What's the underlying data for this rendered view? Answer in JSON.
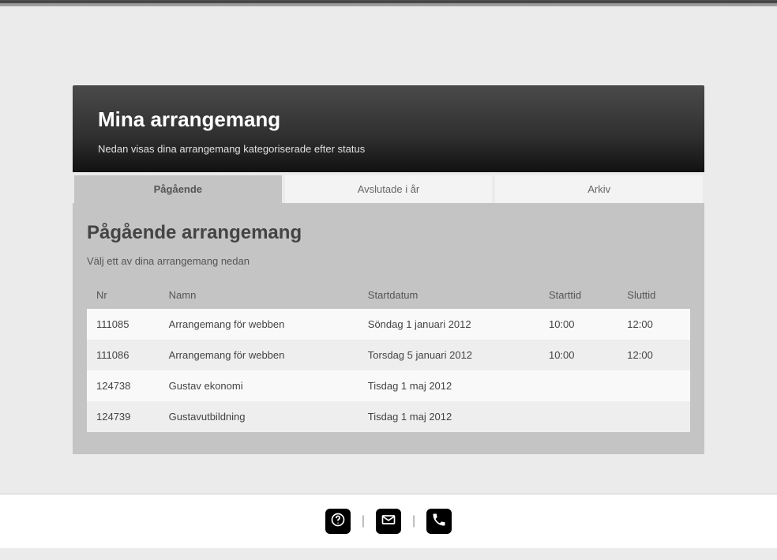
{
  "header": {
    "title": "Mina arrangemang",
    "subtitle": "Nedan visas dina arrangemang kategoriserade efter status"
  },
  "tabs": [
    {
      "label": "Pågående",
      "active": true
    },
    {
      "label": "Avslutade i år",
      "active": false
    },
    {
      "label": "Arkiv",
      "active": false
    }
  ],
  "section": {
    "title": "Pågående arrangemang",
    "subtitle": "Välj ett av dina arrangemang nedan"
  },
  "columns": {
    "nr": "Nr",
    "namn": "Namn",
    "startdatum": "Startdatum",
    "starttid": "Starttid",
    "sluttid": "Sluttid"
  },
  "rows": [
    {
      "nr": "111085",
      "namn": "Arrangemang för webben",
      "startdatum": "Söndag 1 januari 2012",
      "starttid": "10:00",
      "sluttid": "12:00"
    },
    {
      "nr": "111086",
      "namn": "Arrangemang för webben",
      "startdatum": "Torsdag 5 januari 2012",
      "starttid": "10:00",
      "sluttid": "12:00"
    },
    {
      "nr": "124738",
      "namn": "Gustav ekonomi",
      "startdatum": "Tisdag 1 maj 2012",
      "starttid": "",
      "sluttid": ""
    },
    {
      "nr": "124739",
      "namn": "Gustavutbildning",
      "startdatum": "Tisdag 1 maj 2012",
      "starttid": "",
      "sluttid": ""
    }
  ],
  "footer": {
    "divider": "|"
  }
}
